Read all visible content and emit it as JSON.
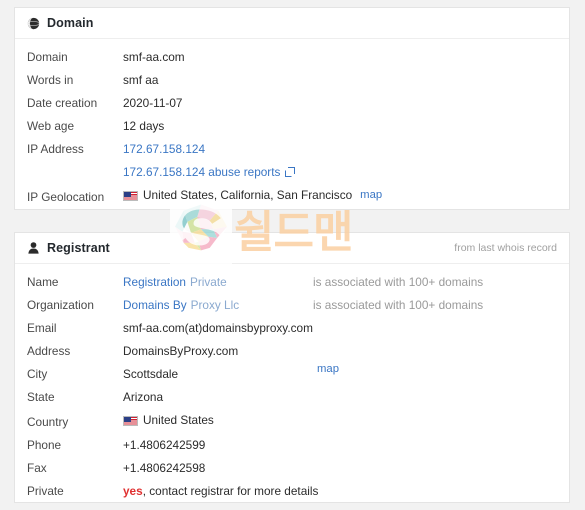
{
  "domain_card": {
    "icon": "globe-icon",
    "title": "Domain",
    "rows": [
      {
        "label": "Domain",
        "value": "smf-aa.com"
      },
      {
        "label": "Words in",
        "value": "smf aa"
      },
      {
        "label": "Date creation",
        "value": "2020-11-07"
      },
      {
        "label": "Web age",
        "value": "12 days"
      },
      {
        "label": "IP Address",
        "value": "172.67.158.124"
      },
      {
        "label": "",
        "value": "172.67.158.124 abuse reports"
      },
      {
        "label": "IP Geolocation",
        "value": "United States, California, San Francisco",
        "map": "map"
      }
    ]
  },
  "registrant_card": {
    "icon": "person-icon",
    "title": "Registrant",
    "note": "from last whois record",
    "rows": [
      {
        "label": "Name",
        "value_link": "Registration",
        "value_soft": "Private",
        "extra": "is associated with 100+ domains"
      },
      {
        "label": "Organization",
        "value_link": "Domains By",
        "value_soft": "Proxy Llc",
        "extra": "is associated with 100+ domains"
      },
      {
        "label": "Email",
        "value": "smf-aa.com(at)domainsbyproxy.com"
      },
      {
        "label": "Address",
        "value": "DomainsByProxy.com"
      },
      {
        "label": "City",
        "value": "Scottsdale",
        "map": "map"
      },
      {
        "label": "State",
        "value": "Arizona"
      },
      {
        "label": "Country",
        "value": "United States"
      },
      {
        "label": "Phone",
        "value": "+1.4806242599"
      },
      {
        "label": "Fax",
        "value": "+1.4806242598"
      },
      {
        "label": "Private",
        "value_red": "yes",
        "value_rest": ", contact registrar for more details"
      }
    ]
  },
  "watermark": {
    "logo": "shieldman-s-logo",
    "text": "쉴드맨"
  },
  "colors": {
    "link": "#3a76c4",
    "link_soft": "#8aa9cf",
    "muted": "#9a9a9a",
    "red": "#e03131",
    "watermark": "#fbd0a2",
    "page_bg": "#f2f2f2",
    "card_bg": "#ffffff"
  }
}
